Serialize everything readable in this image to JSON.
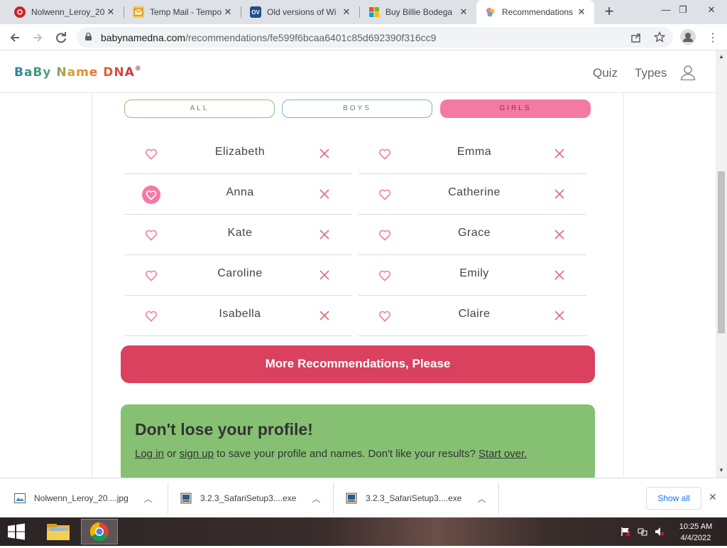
{
  "browser": {
    "tabs": [
      {
        "title": "Nolwenn_Leroy_20",
        "favicon": "pinterest-icon",
        "active": false
      },
      {
        "title": "Temp Mail - Tempo",
        "favicon": "mail-icon",
        "active": false
      },
      {
        "title": "Old versions of Wi",
        "favicon": "ov-icon",
        "favicon_text": "OV",
        "active": false
      },
      {
        "title": "Buy Billie Bodega",
        "favicon": "microsoft-icon",
        "active": false
      },
      {
        "title": "Recommendations",
        "favicon": "babynamedna-icon",
        "active": true
      }
    ],
    "url_domain": "babynamedna.com",
    "url_path": "/recommendations/fe599f6bcaa6401c85d692390f316cc9"
  },
  "site": {
    "logo_text": "BaBy Name DNA",
    "logo_mark": "®",
    "nav": {
      "quiz": "Quiz",
      "types": "Types"
    }
  },
  "filters": {
    "all": "ALL",
    "boys": "BOYS",
    "girls": "GIRLS",
    "selected": "GIRLS"
  },
  "names": {
    "left": [
      {
        "name": "Elizabeth",
        "liked": false
      },
      {
        "name": "Anna",
        "liked": true
      },
      {
        "name": "Kate",
        "liked": false
      },
      {
        "name": "Caroline",
        "liked": false
      },
      {
        "name": "Isabella",
        "liked": false
      }
    ],
    "right": [
      {
        "name": "Emma",
        "liked": false
      },
      {
        "name": "Catherine",
        "liked": false
      },
      {
        "name": "Grace",
        "liked": false
      },
      {
        "name": "Emily",
        "liked": false
      },
      {
        "name": "Claire",
        "liked": false
      }
    ]
  },
  "more_button": "More Recommendations, Please",
  "profile": {
    "heading": "Don't lose your profile!",
    "log_in": "Log in",
    "or": " or ",
    "sign_up": "sign up",
    "middle": " to save your profile and names. Don't like your results? ",
    "start_over": "Start over."
  },
  "downloads": [
    {
      "file": "Nolwenn_Leroy_20....jpg",
      "icon": "image-file-icon"
    },
    {
      "file": "3.2.3_SafariSetup3....exe",
      "icon": "exe-file-icon"
    },
    {
      "file": "3.2.3_SafariSetup3....exe",
      "icon": "exe-file-icon"
    }
  ],
  "show_all": "Show all",
  "taskbar": {
    "time": "10:25 AM",
    "date": "4/4/2022"
  },
  "colors": {
    "girls": "#f47aa5",
    "more_button": "#d9415e",
    "profile_box": "#86c173"
  }
}
